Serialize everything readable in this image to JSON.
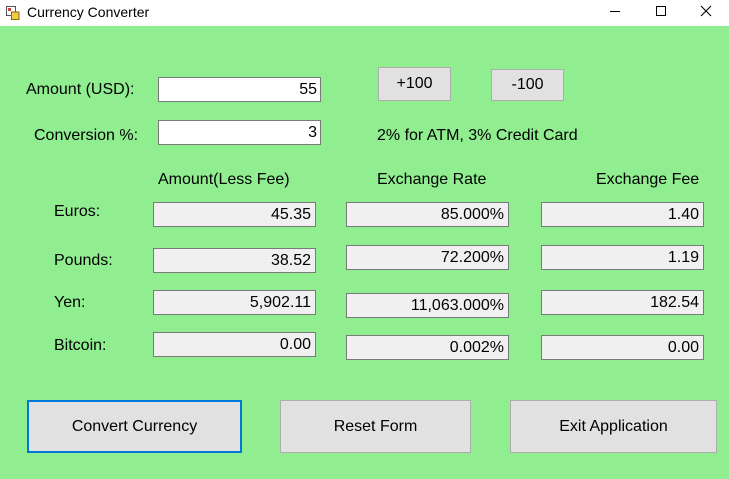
{
  "window": {
    "title": "Currency Converter",
    "icons": {
      "app": "app-icon",
      "minimize": "minimize-icon",
      "maximize": "maximize-icon",
      "close": "close-icon"
    }
  },
  "colors": {
    "form_background": "#90ee90",
    "focus_border": "#0078d7"
  },
  "inputs": {
    "amount_label": "Amount (USD):",
    "amount_value": "55",
    "conversion_label": "Conversion %:",
    "conversion_value": "3",
    "fee_hint": "2% for ATM, 3% Credit Card"
  },
  "buttons": {
    "plus_100": "+100",
    "minus_100": "-100",
    "convert": "Convert Currency",
    "reset": "Reset Form",
    "exit": "Exit Application"
  },
  "headers": {
    "amount_less_fee": "Amount(Less Fee)",
    "exchange_rate": "Exchange Rate",
    "exchange_fee": "Exchange Fee"
  },
  "rows": [
    {
      "label": "Euros:",
      "amount": "45.35",
      "rate": "85.000%",
      "fee": "1.40"
    },
    {
      "label": "Pounds:",
      "amount": "38.52",
      "rate": "72.200%",
      "fee": "1.19"
    },
    {
      "label": "Yen:",
      "amount": "5,902.11",
      "rate": "11,063.000%",
      "fee": "182.54"
    },
    {
      "label": "Bitcoin:",
      "amount": "0.00",
      "rate": "0.002%",
      "fee": "0.00"
    }
  ]
}
